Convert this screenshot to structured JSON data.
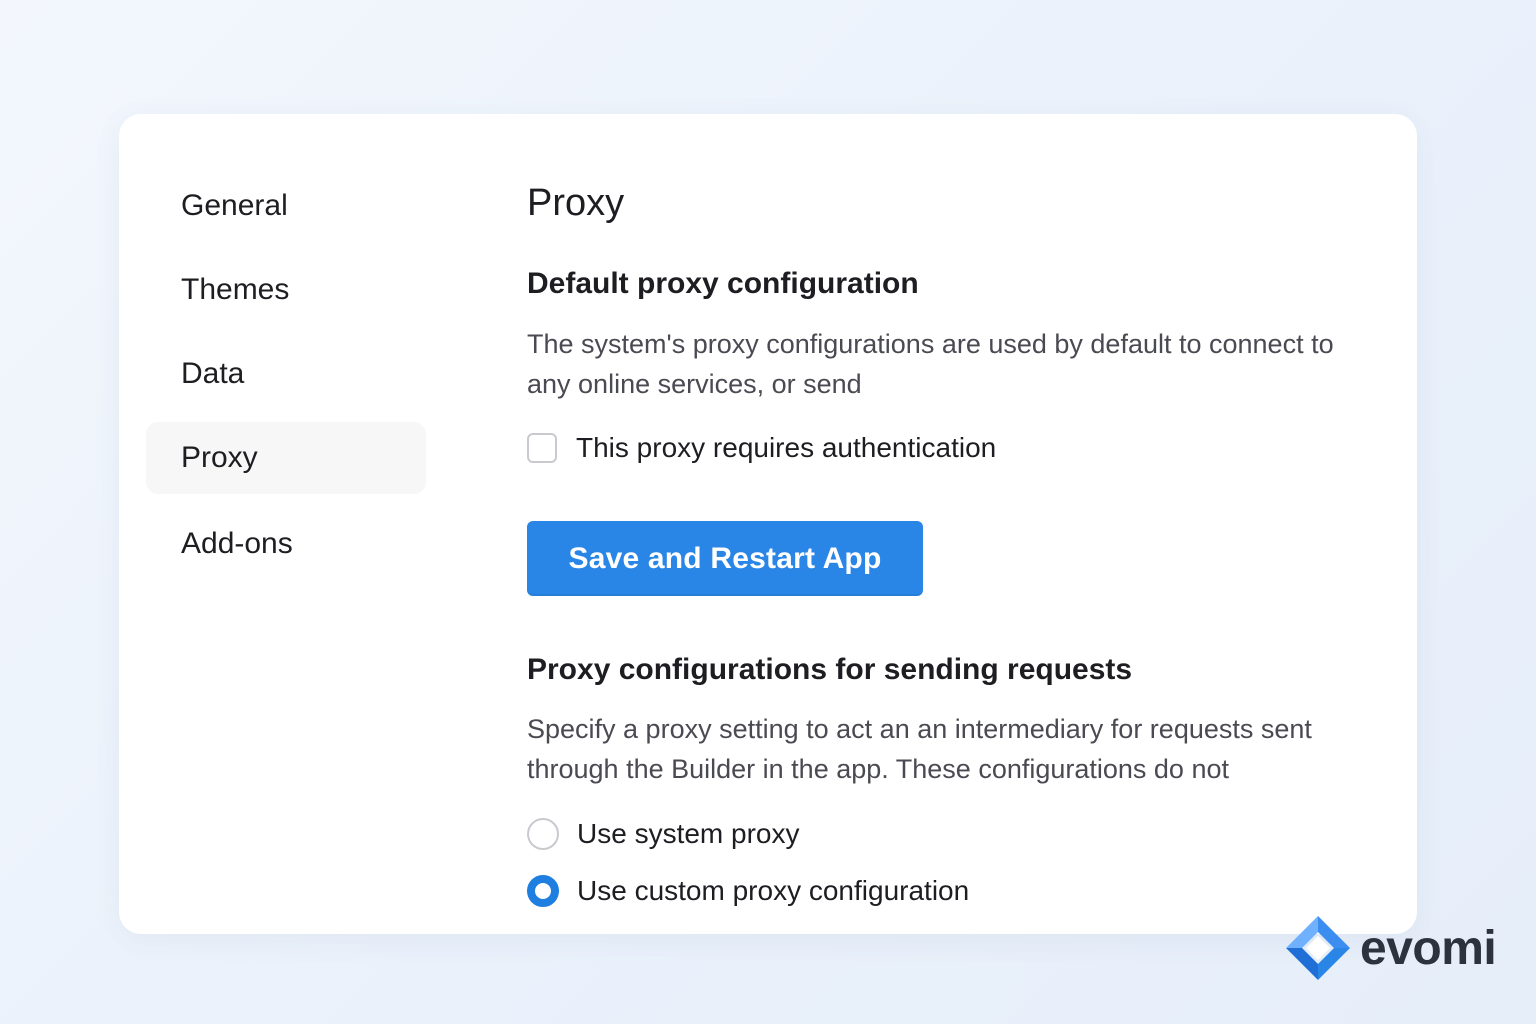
{
  "sidebar": {
    "items": [
      {
        "label": "General",
        "active": false
      },
      {
        "label": "Themes",
        "active": false
      },
      {
        "label": "Data",
        "active": false
      },
      {
        "label": "Proxy",
        "active": true
      },
      {
        "label": "Add-ons",
        "active": false
      }
    ]
  },
  "main": {
    "title": "Proxy",
    "default_section": {
      "title": "Default proxy configuration",
      "description": "The system's proxy configurations are used by default to connect to any online services, or send",
      "auth_checkbox": {
        "label": "This proxy requires authentication",
        "checked": false
      },
      "save_button_label": "Save and Restart App"
    },
    "requests_section": {
      "title": "Proxy configurations for sending requests",
      "description": "Specify a proxy setting to act an an intermediary for requests sent through the Builder in the app. These configurations do not",
      "options": [
        {
          "label": "Use system proxy",
          "selected": false
        },
        {
          "label": "Use custom proxy configuration",
          "selected": true
        }
      ]
    }
  },
  "brand": {
    "name": "evomi",
    "logo_icon": "evomi-logo-icon"
  },
  "colors": {
    "accent": "#2a86e6",
    "radio_selected": "#1f7fe0",
    "card_background": "#ffffff",
    "active_nav_background": "#f7f7f8"
  }
}
